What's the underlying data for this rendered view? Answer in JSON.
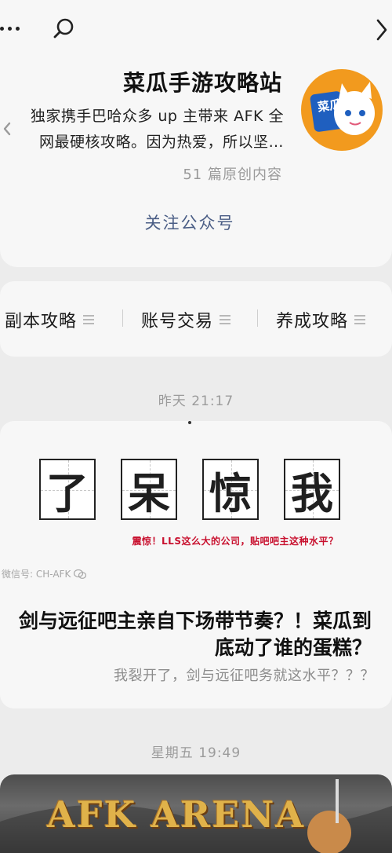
{
  "account": {
    "name": "菜瓜手游攻略站",
    "description": "独家携手巴哈众多 up 主带来 AFK 全网最硬核攻略。因为热爱，所以坚…",
    "original_count": "51 篇原创内容",
    "follow_label": "关注公众号",
    "avatar_text": "菜瓜"
  },
  "menu": {
    "items": [
      {
        "label": "养成攻略",
        "icon": "menu-lines-icon"
      },
      {
        "label": "账号交易",
        "icon": "menu-lines-icon"
      },
      {
        "label": "副本攻略",
        "icon": "menu-lines-icon"
      }
    ]
  },
  "timestamps": {
    "first": "昨天 21:17",
    "second": "星期五 19:49"
  },
  "article": {
    "cover_chars": [
      "我",
      "惊",
      "呆",
      "了"
    ],
    "cover_caption": "震惊！LLS这么大的公司，贴吧吧主这种水平？",
    "wechat_caption": "微信号: CH-AFK",
    "title_line1": "剑与远征吧主亲自下场带节奏？！菜瓜到",
    "title_line2": "底动了谁的蛋糕？",
    "subtitle": "我裂开了，剑与远征吧务就这水平？？？"
  },
  "banner": {
    "title": "AFK ARENA"
  },
  "colors": {
    "link": "#4a5d85",
    "avatar_bg": "#f29a1e",
    "caption_red": "#c8102e"
  }
}
